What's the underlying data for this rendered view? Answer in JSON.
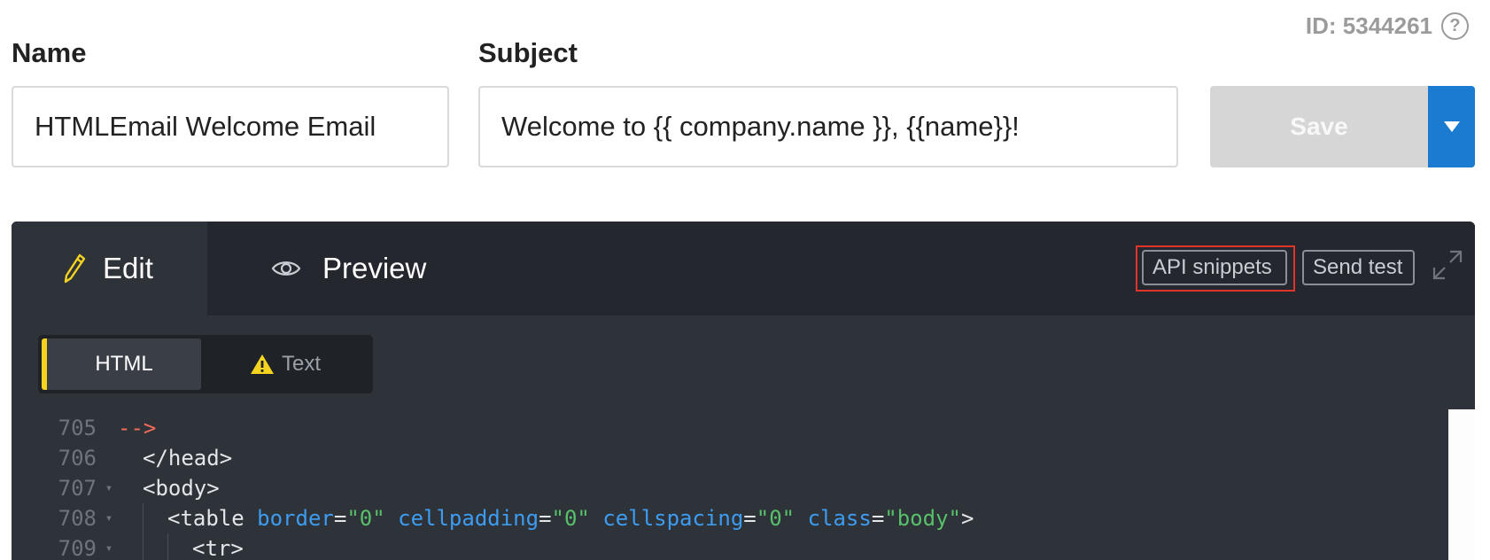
{
  "header": {
    "id_text": "ID: 5344261",
    "help_icon": "?"
  },
  "form": {
    "name_label": "Name",
    "name_value": "HTMLEmail Welcome Email",
    "subject_label": "Subject",
    "subject_value": "Welcome to {{ company.name }}, {{name}}!"
  },
  "save": {
    "label": "Save",
    "dropdown_icon": "caret-down-icon",
    "accent_color": "#1a7bd0"
  },
  "editor": {
    "tabs": [
      {
        "label": "Edit",
        "icon": "pencil-icon",
        "active": true
      },
      {
        "label": "Preview",
        "icon": "eye-icon",
        "active": false
      }
    ],
    "api_snippets_label": "API snippets",
    "send_test_label": "Send test",
    "expand_icon": "expand-icon",
    "subtabs": [
      {
        "label": "HTML",
        "active": true
      },
      {
        "label": "Text",
        "icon": "warning-icon",
        "active": false
      }
    ],
    "code_lines": [
      {
        "num": "705",
        "text": "-->"
      },
      {
        "num": "706",
        "text": "</head>"
      },
      {
        "num": "707",
        "text": "<body>"
      },
      {
        "num": "708",
        "tag_open": "<table",
        "attrs": [
          {
            "name": "border",
            "value": "\"0\""
          },
          {
            "name": "cellpadding",
            "value": "\"0\""
          },
          {
            "name": "cellspacing",
            "value": "\"0\""
          },
          {
            "name": "class",
            "value": "\"body\""
          }
        ],
        "tag_close": ">"
      },
      {
        "num": "709",
        "text": "<tr>"
      }
    ],
    "colors": {
      "comment": "#f36d5a",
      "attr": "#3d9cf0",
      "string": "#58c06a",
      "active_marker": "#f5d31e"
    }
  }
}
